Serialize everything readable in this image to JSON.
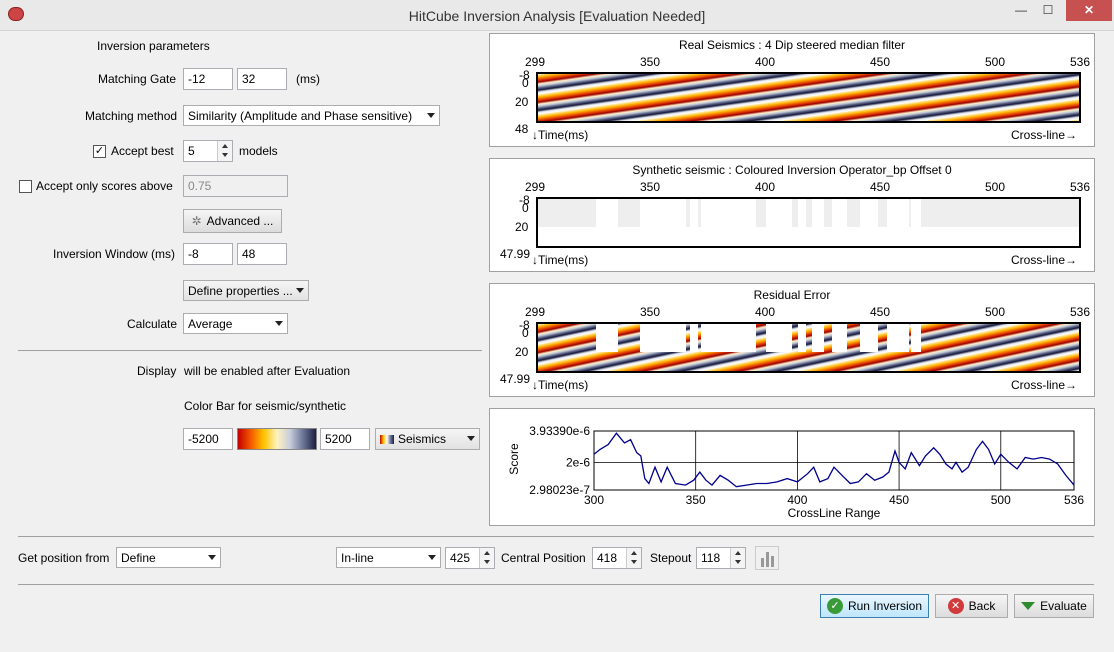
{
  "window": {
    "title": "HitCube Inversion Analysis [Evaluation Needed]",
    "min": "—",
    "max": "☐",
    "close": "✕"
  },
  "params": {
    "heading": "Inversion parameters",
    "matching_gate_label": "Matching Gate",
    "gate_from": "-12",
    "gate_to": "32",
    "gate_unit": "(ms)",
    "matching_method_label": "Matching method",
    "matching_method_value": "Similarity (Amplitude and Phase sensitive)",
    "accept_best_label": "Accept best",
    "accept_best_checked": true,
    "accept_best_value": "5",
    "models_label": "models",
    "accept_scores_label": "Accept only scores above",
    "accept_scores_checked": false,
    "accept_scores_value": "0.75",
    "advanced_label": "Advanced ...",
    "window_label": "Inversion Window (ms)",
    "window_from": "-8",
    "window_to": "48",
    "define_props_label": "Define properties ...",
    "calculate_label": "Calculate",
    "calculate_value": "Average"
  },
  "display": {
    "label_a": "Display",
    "label_b": "will be enabled after Evaluation",
    "colorbar_label": "Color Bar for seismic/synthetic",
    "min": "-5200",
    "max": "5200",
    "colortable": "Seismics"
  },
  "panels": [
    {
      "title": "Real Seismics : 4 Dip steered median filter",
      "xticks": [
        "299",
        "350",
        "400",
        "450",
        "500",
        "536"
      ],
      "yticks": [
        "-8",
        "0",
        "20",
        "48"
      ],
      "ylabel": "↓Time(ms)",
      "xlabel": "Cross-line→"
    },
    {
      "title": "Synthetic seismic : Coloured Inversion Operator_bp Offset 0",
      "xticks": [
        "299",
        "350",
        "400",
        "450",
        "500",
        "536"
      ],
      "yticks": [
        "-8",
        "0",
        "20",
        "47.99"
      ],
      "ylabel": "↓Time(ms)",
      "xlabel": "Cross-line→"
    },
    {
      "title": "Residual Error",
      "xticks": [
        "299",
        "350",
        "400",
        "450",
        "500",
        "536"
      ],
      "yticks": [
        "-8",
        "0",
        "20",
        "47.99"
      ],
      "ylabel": "↓Time(ms)",
      "xlabel": "Cross-line→"
    }
  ],
  "chart_data": {
    "type": "line",
    "title": "",
    "xlabel": "CrossLine Range",
    "ylabel": "Score",
    "xticks": [
      "300",
      "350",
      "400",
      "450",
      "500",
      "536"
    ],
    "yticks": [
      "3.93390e-6",
      "2e-6",
      "2.98023e-7"
    ],
    "xlim": [
      300,
      536
    ],
    "ylim": [
      2.98023e-07,
      3.9339e-06
    ],
    "color": "#00008b",
    "x": [
      300,
      303,
      307,
      311,
      315,
      318,
      321,
      323,
      325,
      327,
      330,
      333,
      336,
      340,
      345,
      349,
      352,
      355,
      358,
      362,
      366,
      370,
      375,
      380,
      385,
      390,
      395,
      400,
      405,
      408,
      411,
      415,
      418,
      422,
      426,
      430,
      434,
      438,
      442,
      445,
      448,
      450,
      453,
      456,
      460,
      463,
      467,
      470,
      473,
      476,
      478,
      481,
      484,
      488,
      491,
      494,
      497,
      500,
      504,
      508,
      512,
      516,
      520,
      524,
      528,
      532,
      536
    ],
    "y": [
      2.5e-06,
      2.8e-06,
      3.1e-06,
      3.8e-06,
      3.2e-06,
      3.4e-06,
      2.6e-06,
      2.4e-06,
      1e-06,
      7e-07,
      1.7e-06,
      8e-07,
      1.7e-06,
      7e-07,
      6e-07,
      9e-07,
      1.4e-06,
      9e-07,
      6e-07,
      1.2e-06,
      9e-07,
      5e-07,
      6e-07,
      7e-07,
      7e-07,
      8e-07,
      1e-06,
      8e-07,
      1.3e-06,
      1.7e-06,
      8e-07,
      1e-06,
      1.7e-06,
      1.2e-06,
      7e-07,
      8e-07,
      1.3e-06,
      9e-07,
      1.1e-06,
      1.4e-06,
      2.7e-06,
      2e-06,
      1.6e-06,
      2.6e-06,
      1.8e-06,
      2.4e-06,
      2.9e-06,
      2.5e-06,
      1.9e-06,
      1.6e-06,
      2e-06,
      1.4e-06,
      1.7e-06,
      2.8e-06,
      3.3e-06,
      2.8e-06,
      1.9e-06,
      2.5e-06,
      2e-06,
      1.6e-06,
      2.3e-06,
      2.2e-06,
      2.3e-06,
      2.2e-06,
      1.9e-06,
      1.2e-06,
      6e-07
    ]
  },
  "bottom": {
    "get_position_label": "Get position from",
    "get_position_value": "Define",
    "inline_value": "In-line",
    "inline_number": "425",
    "central_label": "Central Position",
    "central_value": "418",
    "stepout_label": "Stepout",
    "stepout_value": "118"
  },
  "actions": {
    "run": "Run Inversion",
    "back": "Back",
    "evaluate": "Evaluate"
  }
}
